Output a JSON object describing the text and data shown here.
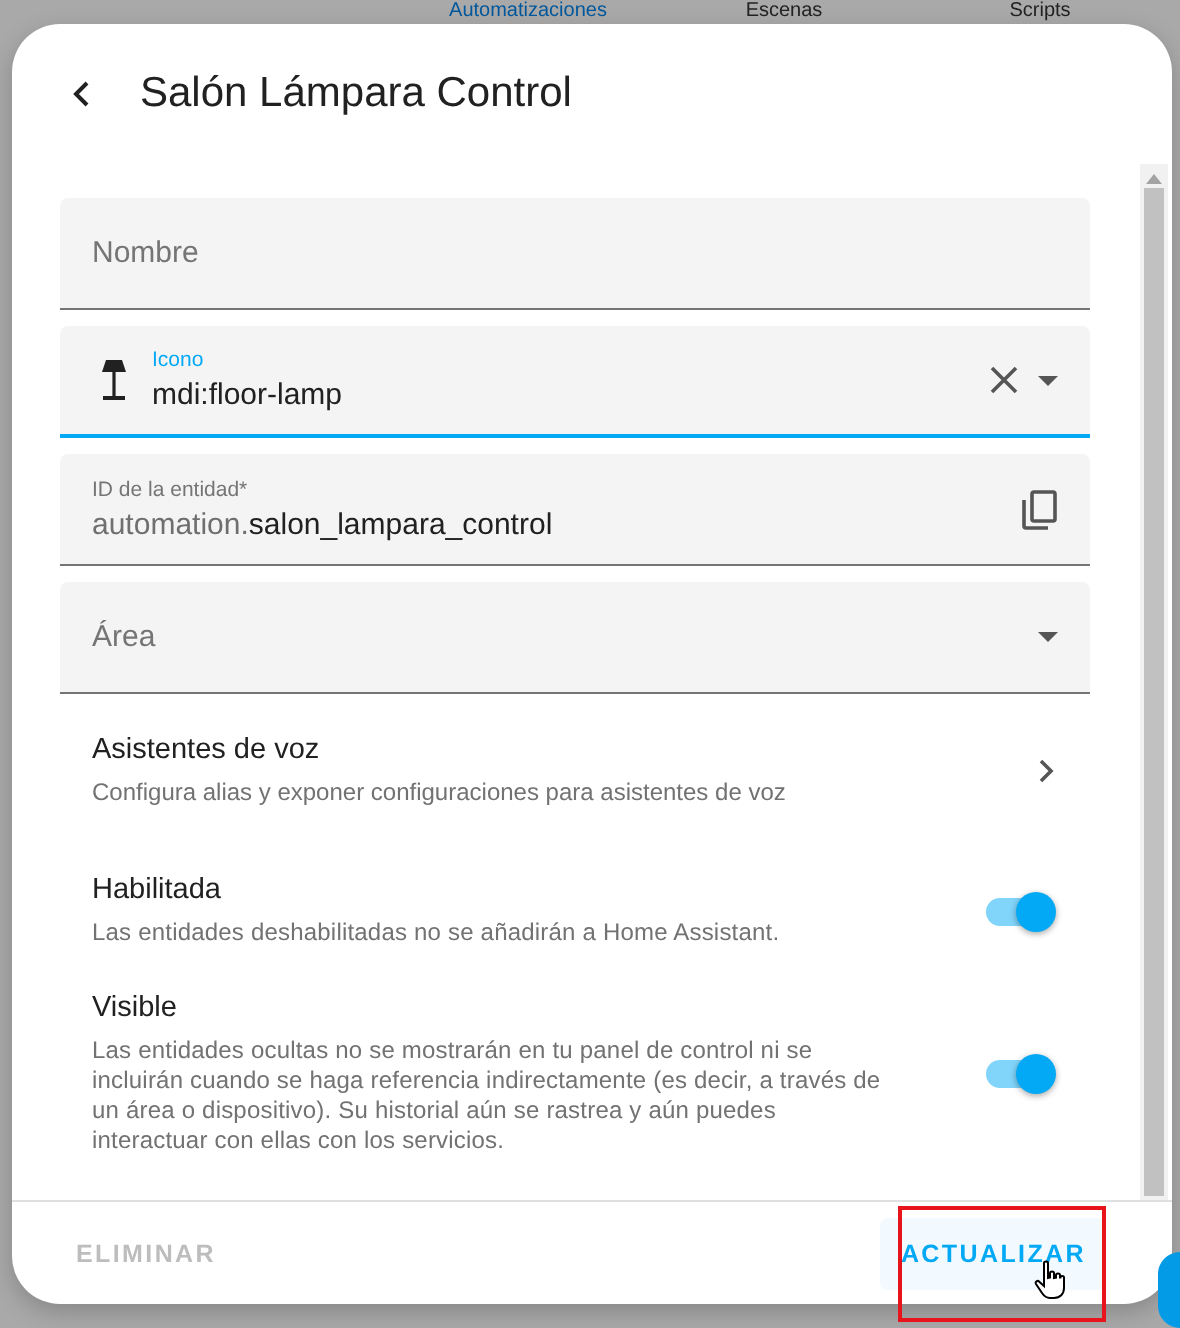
{
  "background_tabs": [
    {
      "label": "Automatizaciones",
      "selected": true
    },
    {
      "label": "Escenas",
      "selected": false
    },
    {
      "label": "Scripts",
      "selected": false
    }
  ],
  "dialog": {
    "title": "Salón Lámpara Control"
  },
  "fields": [
    {
      "kind": "text",
      "placeholder": "Nombre"
    },
    {
      "kind": "icon-picker",
      "label": "Icono",
      "value": "mdi:floor-lamp",
      "focused": true
    },
    {
      "kind": "entity-id",
      "label": "ID de la entidad*",
      "prefix": "automation.",
      "value": "salon_lampara_control"
    },
    {
      "kind": "select",
      "placeholder": "Área"
    }
  ],
  "link_row": {
    "title": "Asistentes de voz",
    "description": "Configura alias y exponer configuraciones para asistentes de voz"
  },
  "toggles": [
    {
      "title": "Habilitada",
      "description": "Las entidades deshabilitadas no se añadirán a Home Assistant.",
      "on": true
    },
    {
      "title": "Visible",
      "description": "Las entidades ocultas no se mostrarán en tu panel de control ni se incluirán cuando se haga referencia indirectamente (es decir, a través de un área o dispositivo). Su historial aún se rastrea y aún puedes interactuar con ellas con los servicios.",
      "on": true
    }
  ],
  "buttons": [
    {
      "label": "ELIMINAR",
      "disabled": true,
      "highlighted": false
    },
    {
      "label": "ACTUALIZAR",
      "disabled": false,
      "highlighted": true
    }
  ]
}
